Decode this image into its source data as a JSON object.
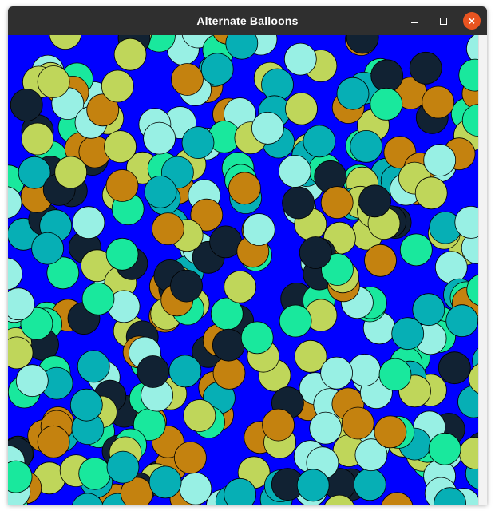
{
  "window": {
    "title": "Alternate Balloons",
    "controls": {
      "minimize_label": "–",
      "maximize_label": "□",
      "close_label": "×"
    }
  },
  "canvas": {
    "background": "#0000ff",
    "balloon_palette": {
      "gold": "#c4820f",
      "lime": "#bfd65a",
      "aqua": "#98f0e4",
      "mint": "#19e89d",
      "teal": "#06afb5",
      "navy": "#112233"
    }
  }
}
